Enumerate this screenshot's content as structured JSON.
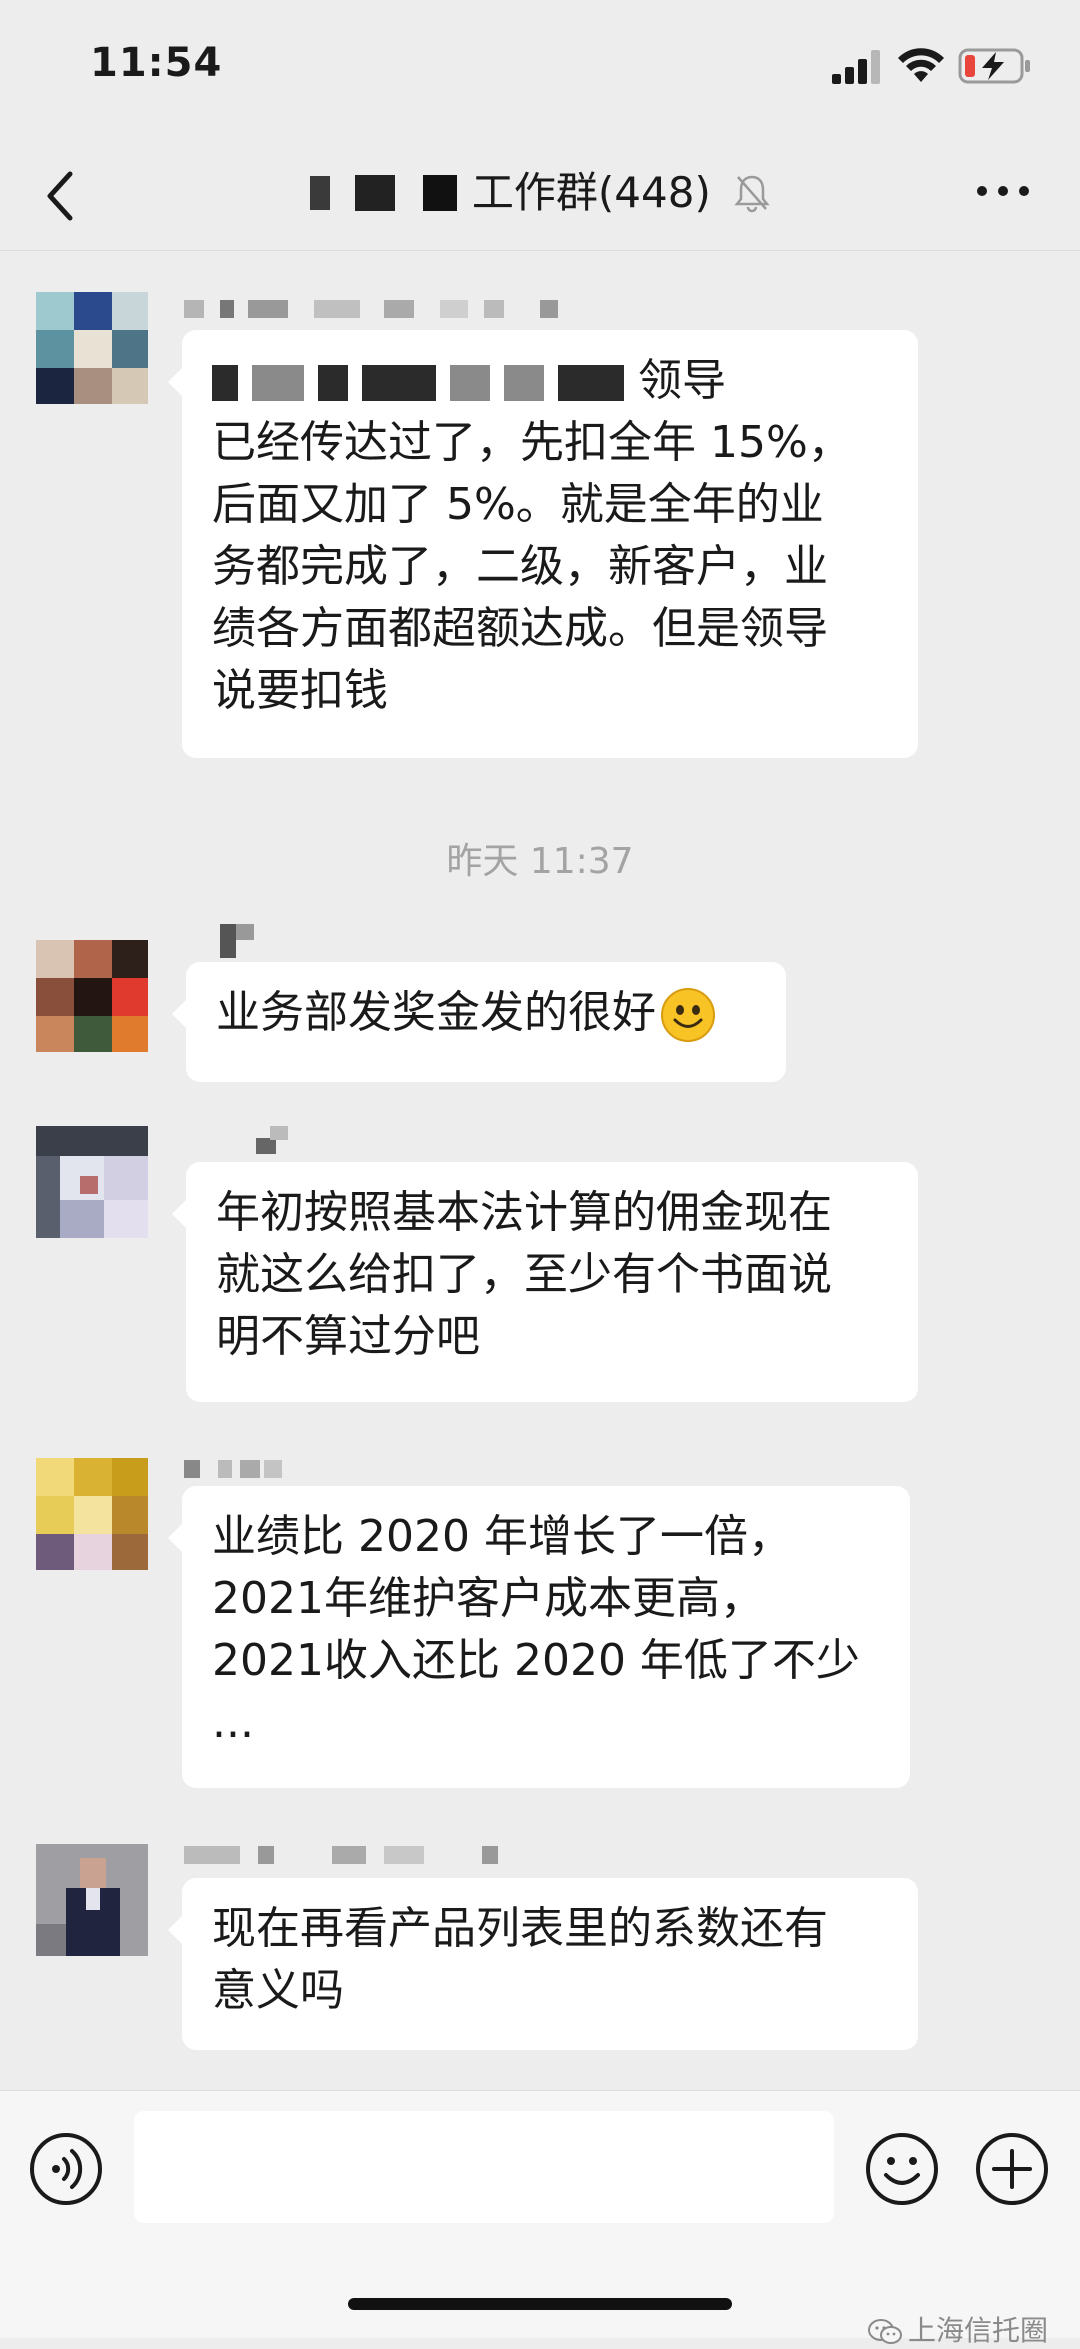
{
  "status_bar": {
    "time": "11:54",
    "signal_icon": "cellular-signal-icon",
    "wifi_icon": "wifi-icon",
    "battery_icon": "battery-low-charging-icon",
    "battery_color": "#e8453c"
  },
  "nav": {
    "back_icon": "chevron-left-icon",
    "title": "工作群(448)",
    "mute_icon": "bell-muted-icon",
    "more_icon": "more-dots-icon"
  },
  "messages": [
    {
      "lines": [
        "领导",
        "已经传达过了，先扣全年 15%，",
        "后面又加了 5%。就是全年的业",
        "务都完成了，二级，新客户，业",
        "绩各方面都超额达成。但是领导",
        "说要扣钱"
      ]
    },
    {
      "lines": [
        "业务部发奖金发的很好"
      ],
      "emoji": "smiling-face-emoji"
    },
    {
      "lines": [
        "年初按照基本法计算的佣金现在",
        "就这么给扣了，至少有个书面说",
        "明不算过分吧"
      ]
    },
    {
      "lines": [
        "业绩比 2020 年增长了一倍，",
        "2021年维护客户成本更高，",
        "2021收入还比 2020 年低了不少",
        "..."
      ]
    },
    {
      "lines": [
        "现在再看产品列表里的系数还有",
        "意义吗"
      ]
    }
  ],
  "time_separator": "昨天 11:37",
  "bottom_bar": {
    "voice_icon": "voice-input-icon",
    "emoji_icon": "emoji-face-icon",
    "plus_icon": "plus-circle-icon",
    "input_value": ""
  },
  "watermark": {
    "icon": "wechat-official-account-icon",
    "text": "上海信托圈"
  },
  "colors": {
    "background": "#ededed",
    "bubble": "#ffffff",
    "text": "#1a1a1a",
    "timestamp": "#a3a3a3"
  }
}
